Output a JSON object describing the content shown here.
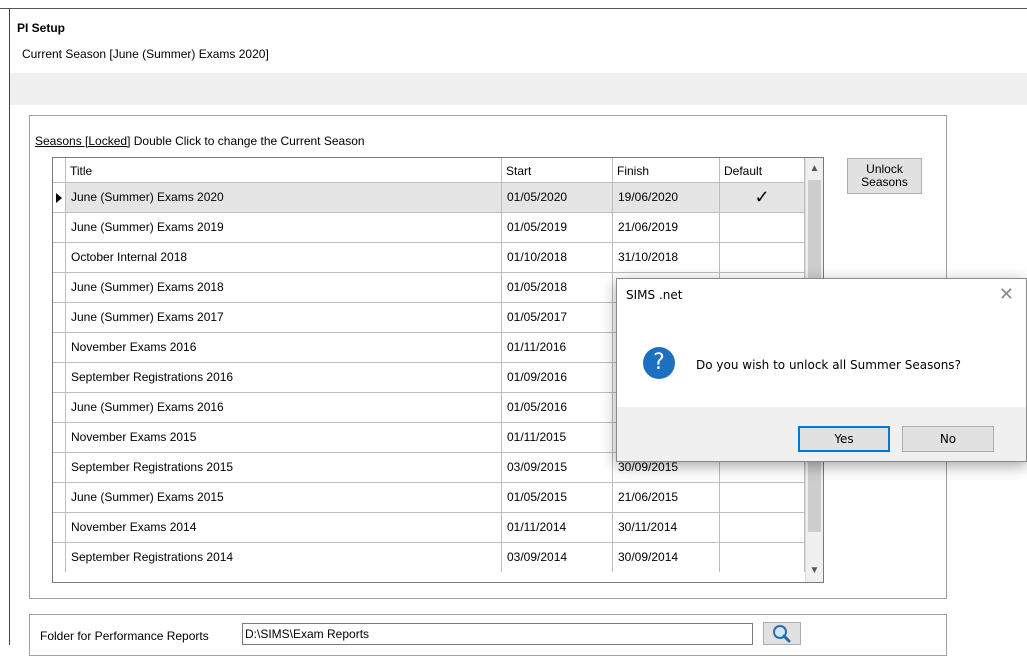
{
  "window": {
    "title": "PI Setup",
    "current_season_text": "Current Season [June (Summer) Exams 2020]"
  },
  "seasons": {
    "caption_locked": "Seasons [Locked]",
    "caption_hint": " Double Click to change the Current Season",
    "columns": {
      "title": "Title",
      "start": "Start",
      "finish": "Finish",
      "default": "Default"
    },
    "rows": [
      {
        "title": "June (Summer) Exams 2020",
        "start": "01/05/2020",
        "finish": "19/06/2020",
        "default": "✓"
      },
      {
        "title": "June (Summer) Exams 2019",
        "start": "01/05/2019",
        "finish": "21/06/2019",
        "default": ""
      },
      {
        "title": "October Internal 2018",
        "start": "01/10/2018",
        "finish": "31/10/2018",
        "default": ""
      },
      {
        "title": "June (Summer) Exams 2018",
        "start": "01/05/2018",
        "finish": "",
        "default": ""
      },
      {
        "title": "June (Summer) Exams 2017",
        "start": "01/05/2017",
        "finish": "",
        "default": ""
      },
      {
        "title": "November Exams 2016",
        "start": "01/11/2016",
        "finish": "",
        "default": ""
      },
      {
        "title": "September Registrations 2016",
        "start": "01/09/2016",
        "finish": "",
        "default": ""
      },
      {
        "title": "June (Summer) Exams 2016",
        "start": "01/05/2016",
        "finish": "",
        "default": ""
      },
      {
        "title": "November Exams 2015",
        "start": "01/11/2015",
        "finish": "",
        "default": ""
      },
      {
        "title": "September Registrations 2015",
        "start": "03/09/2015",
        "finish": "30/09/2015",
        "default": ""
      },
      {
        "title": "June (Summer) Exams 2015",
        "start": "01/05/2015",
        "finish": "21/06/2015",
        "default": ""
      },
      {
        "title": "November Exams 2014",
        "start": "01/11/2014",
        "finish": "30/11/2014",
        "default": ""
      },
      {
        "title": "September Registrations 2014",
        "start": "03/09/2014",
        "finish": "30/09/2014",
        "default": ""
      }
    ]
  },
  "unlock_button": {
    "line1": "Unlock",
    "line2": "Seasons"
  },
  "folder": {
    "label": "Folder for Performance Reports",
    "value": "D:\\SIMS\\Exam Reports",
    "search_icon": "magnifier-icon"
  },
  "dialog": {
    "title": "SIMS .net",
    "close_glyph": "✕",
    "icon": "question-icon",
    "icon_glyph": "?",
    "message": "Do you wish to unlock all Summer Seasons?",
    "yes_label": "Yes",
    "no_label": "No",
    "accent": "#0078d7",
    "icon_color": "#1d6fc0"
  }
}
